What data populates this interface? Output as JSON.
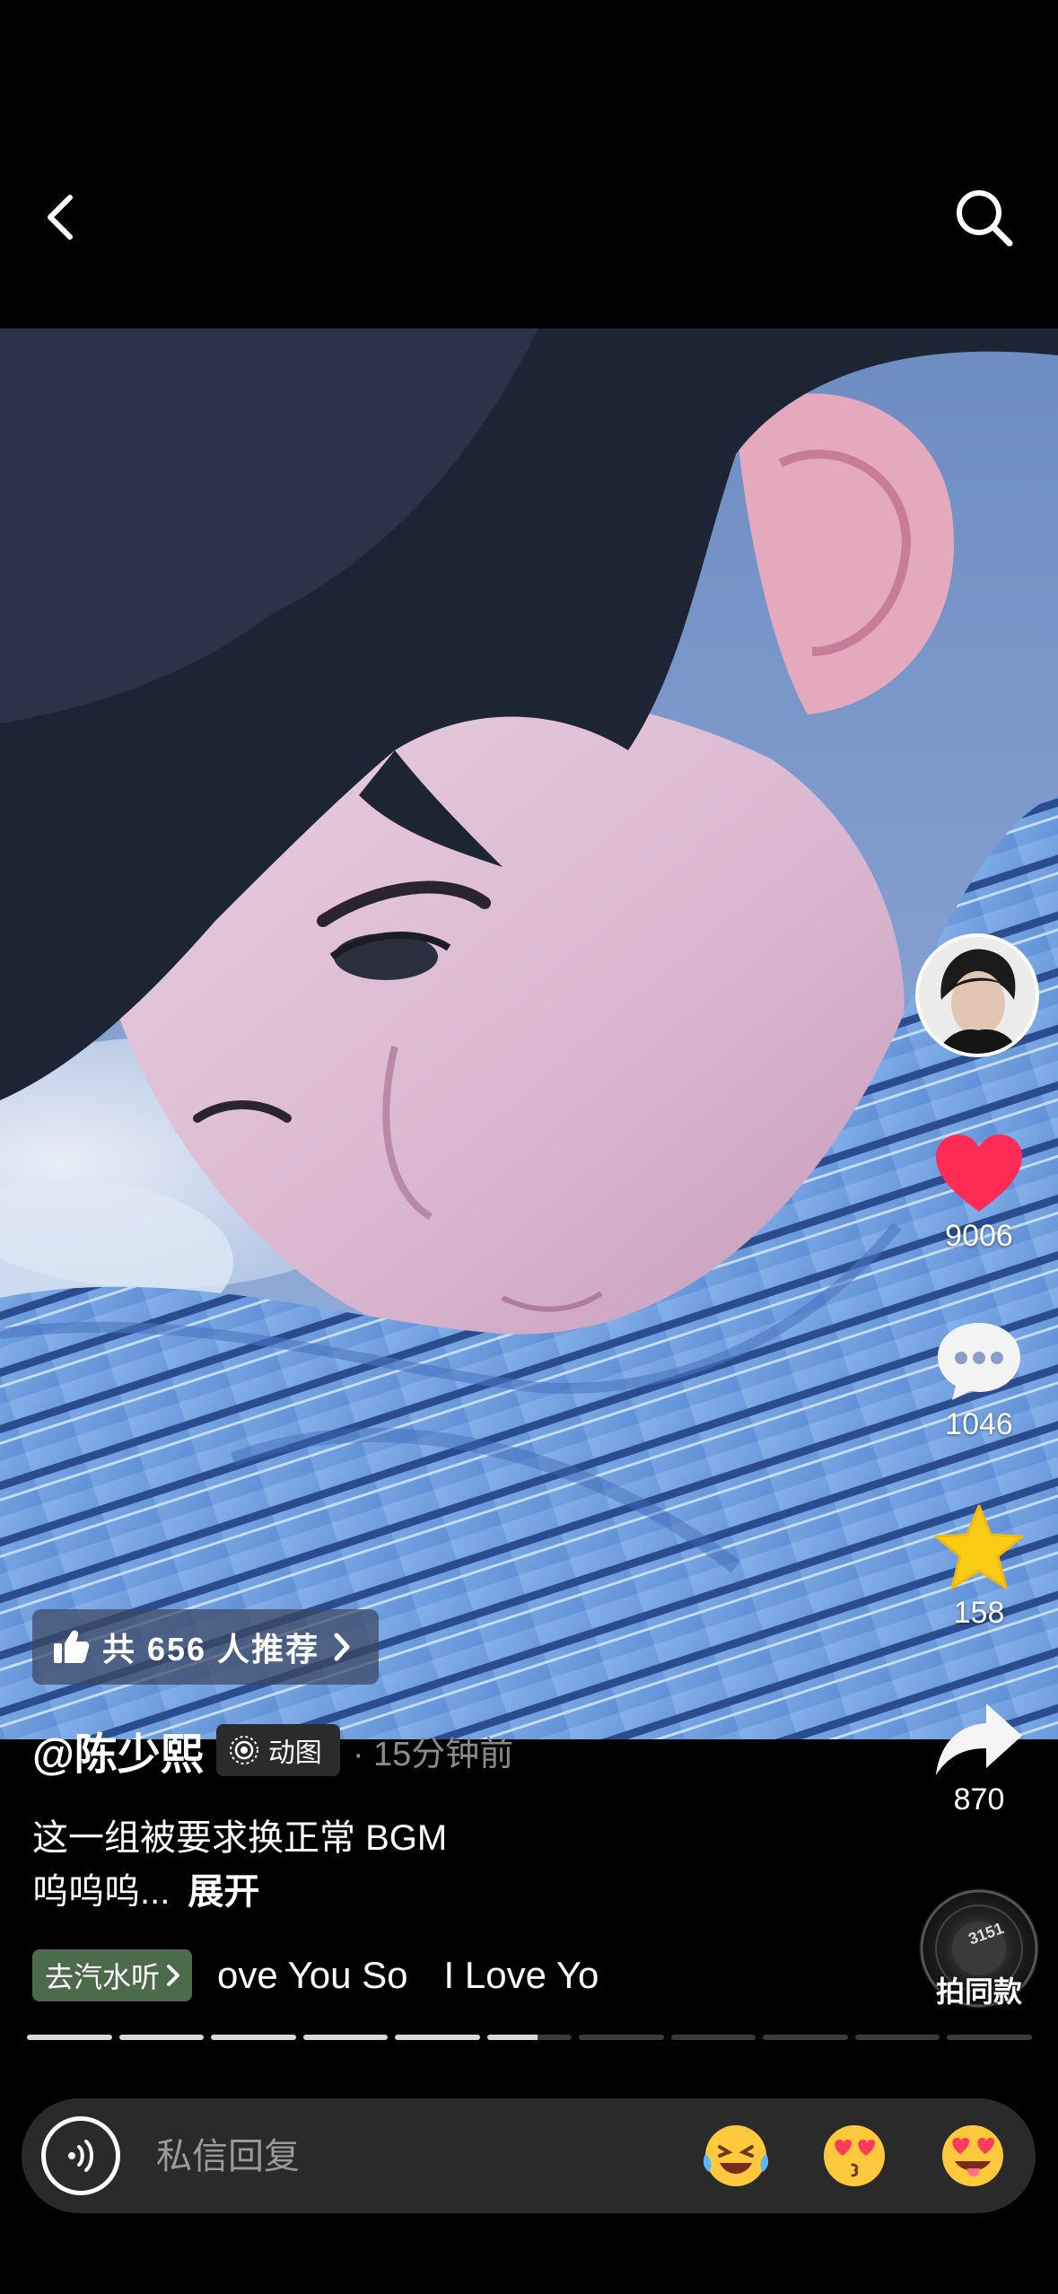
{
  "nav": {
    "back_icon": "chevron-left-icon",
    "search_icon": "search-icon"
  },
  "recommend": {
    "icon": "thumbs-up-icon",
    "label": "共 656 人推荐"
  },
  "rail": {
    "likes": "9006",
    "comments": "1046",
    "favorites": "158",
    "shares": "870"
  },
  "post": {
    "author": "@陈少熙",
    "badge": "动图",
    "time": "· 15分钟前",
    "caption_line1": "这一组被要求换正常 BGM",
    "caption_line2": "呜呜呜...",
    "expand": "展开"
  },
  "music": {
    "button": "去汽水听",
    "marquee_a": "ove You So",
    "marquee_b": "I Love Yo"
  },
  "same_style": {
    "label": "拍同款"
  },
  "progress": {
    "segments": 11,
    "completed": 5,
    "current_fill": 0.6
  },
  "reply": {
    "placeholder": "私信回复",
    "emojis": [
      "laughing-crying-emoji",
      "heart-eyes-kiss-emoji",
      "heart-eyes-tongue-emoji"
    ]
  },
  "colors": {
    "like": "#fe2c55",
    "favorite": "#facc15",
    "music_button": "#4c6b4a"
  }
}
